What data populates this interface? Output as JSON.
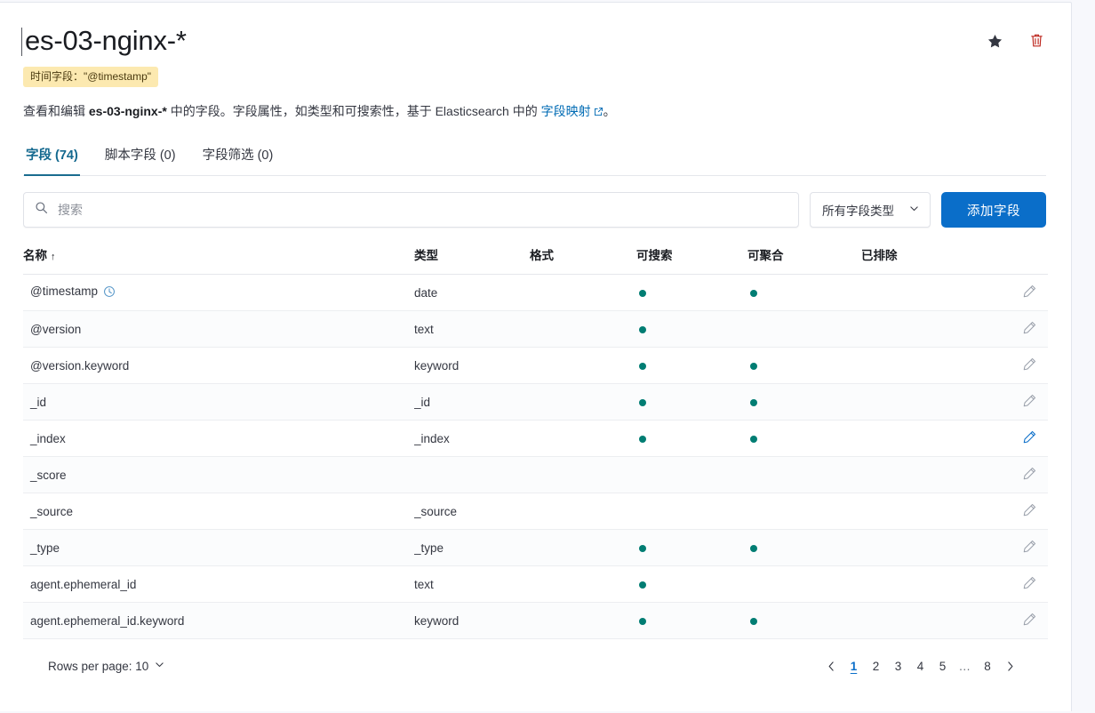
{
  "header": {
    "title": "es-03-nginx-*",
    "time_field_badge": "时间字段：\"@timestamp\"",
    "favorite_icon": "star-icon",
    "delete_icon": "trash-icon",
    "description_prefix": "查看和编辑 ",
    "description_index": "es-03-nginx-*",
    "description_middle": " 中的字段。字段属性，如类型和可搜索性，基于 Elasticsearch 中的 ",
    "description_link": "字段映射",
    "description_suffix": "。"
  },
  "tabs": [
    {
      "label": "字段 (74)",
      "active": true
    },
    {
      "label": "脚本字段 (0)",
      "active": false
    },
    {
      "label": "字段筛选 (0)",
      "active": false
    }
  ],
  "controls": {
    "search_placeholder": "搜索",
    "search_value": "",
    "search_icon": "search-icon",
    "field_type_select": "所有字段类型",
    "chevron_icon": "chevron-down-icon",
    "add_field_label": "添加字段"
  },
  "table": {
    "columns": [
      {
        "label": "名称",
        "sort": "↑"
      },
      {
        "label": "类型",
        "sort": ""
      },
      {
        "label": "格式",
        "sort": ""
      },
      {
        "label": "可搜索",
        "sort": ""
      },
      {
        "label": "可聚合",
        "sort": ""
      },
      {
        "label": "已排除",
        "sort": ""
      },
      {
        "label": "",
        "sort": ""
      }
    ],
    "rows": [
      {
        "name": "@timestamp",
        "time_icon": true,
        "type": "date",
        "format": "",
        "searchable": true,
        "aggregatable": true,
        "excluded": false,
        "edit_active": false
      },
      {
        "name": "@version",
        "time_icon": false,
        "type": "text",
        "format": "",
        "searchable": true,
        "aggregatable": false,
        "excluded": false,
        "edit_active": false
      },
      {
        "name": "@version.keyword",
        "time_icon": false,
        "type": "keyword",
        "format": "",
        "searchable": true,
        "aggregatable": true,
        "excluded": false,
        "edit_active": false
      },
      {
        "name": "_id",
        "time_icon": false,
        "type": "_id",
        "format": "",
        "searchable": true,
        "aggregatable": true,
        "excluded": false,
        "edit_active": false
      },
      {
        "name": "_index",
        "time_icon": false,
        "type": "_index",
        "format": "",
        "searchable": true,
        "aggregatable": true,
        "excluded": false,
        "edit_active": true
      },
      {
        "name": "_score",
        "time_icon": false,
        "type": "",
        "format": "",
        "searchable": false,
        "aggregatable": false,
        "excluded": false,
        "edit_active": false
      },
      {
        "name": "_source",
        "time_icon": false,
        "type": "_source",
        "format": "",
        "searchable": false,
        "aggregatable": false,
        "excluded": false,
        "edit_active": false
      },
      {
        "name": "_type",
        "time_icon": false,
        "type": "_type",
        "format": "",
        "searchable": true,
        "aggregatable": true,
        "excluded": false,
        "edit_active": false
      },
      {
        "name": "agent.ephemeral_id",
        "time_icon": false,
        "type": "text",
        "format": "",
        "searchable": true,
        "aggregatable": false,
        "excluded": false,
        "edit_active": false
      },
      {
        "name": "agent.ephemeral_id.keyword",
        "time_icon": false,
        "type": "keyword",
        "format": "",
        "searchable": true,
        "aggregatable": true,
        "excluded": false,
        "edit_active": false
      }
    ]
  },
  "footer": {
    "rows_per_page_label": "Rows per page: 10",
    "prev_icon": "chevron-left-icon",
    "next_icon": "chevron-right-icon",
    "pages": [
      "1",
      "2",
      "3",
      "4",
      "5",
      "…",
      "8"
    ],
    "active_page": "1"
  },
  "colors": {
    "accent_blue": "#0a6ec9",
    "tab_active": "#1a6c8f",
    "dot_green": "#017d73",
    "badge_yellow": "#fce9b0",
    "delete_red": "#bd271e",
    "link_blue": "#006bb4"
  }
}
